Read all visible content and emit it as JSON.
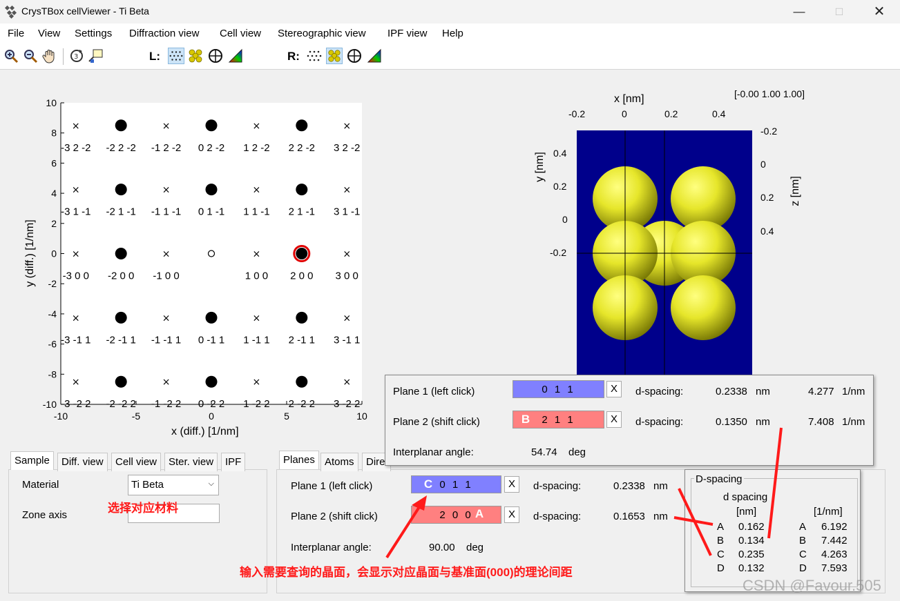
{
  "window": {
    "title": "CrysTBox cellViewer - Ti Beta",
    "icons": {
      "app": "crystal-app-icon",
      "minimize": "minimize-icon",
      "maximize": "maximize-icon",
      "close": "close-icon"
    }
  },
  "menu": [
    "File",
    "View",
    "Settings",
    "Diffraction view",
    "Cell view",
    "Stereographic view",
    "IPF view",
    "Help"
  ],
  "toolbar": {
    "left_label": "L:",
    "right_label": "R:",
    "icons": [
      "zoom-in-icon",
      "zoom-out-icon",
      "pan-hand-icon",
      "rotate-3d-icon",
      "data-cursor-icon"
    ],
    "left_group_icons": [
      "pattern-dots-icon",
      "atoms-icon",
      "stereo-net-icon",
      "color-triangle-icon"
    ],
    "right_group_icons": [
      "pattern-dots-icon",
      "atoms-icon",
      "stereo-net-icon",
      "color-triangle-icon"
    ]
  },
  "diffraction": {
    "xlabel": "x (diff.) [1/nm]",
    "ylabel": "y (diff.) [1/nm]",
    "xticks": [
      "-10",
      "-5",
      "0",
      "5",
      "10"
    ],
    "yticks": [
      "10",
      "8",
      "6",
      "4",
      "2",
      "0",
      "-2",
      "-4",
      "-6",
      "-8",
      "-10"
    ],
    "xlim": [
      -10,
      10
    ],
    "ylim": [
      -10,
      10
    ],
    "rows": [
      {
        "y": 8.5,
        "labels": [
          "-3 2 -2",
          "-2 2 -2",
          "-1 2 -2",
          "0 2 -2",
          "1 2 -2",
          "2 2 -2",
          "3 2 -2"
        ]
      },
      {
        "y": 4.25,
        "labels": [
          "-3 1 -1",
          "-2 1 -1",
          "-1 1 -1",
          "0 1 -1",
          "1 1 -1",
          "2 1 -1",
          "3 1 -1"
        ]
      },
      {
        "y": 0,
        "labels": [
          "-3 0 0",
          "-2 0 0",
          "-1 0 0",
          "",
          "1 0 0",
          "2 0 0",
          "3 0 0"
        ]
      },
      {
        "y": -4.25,
        "labels": [
          "-3 -1 1",
          "-2 -1 1",
          "-1 -1 1",
          "0 -1 1",
          "1 -1 1",
          "2 -1 1",
          "3 -1 1"
        ]
      },
      {
        "y": -8.5,
        "labels": [
          "-3 -2 2",
          "-2 -2 2",
          "-1 -2 2",
          "0 -2 2",
          "1 -2 2",
          "2 -2 2",
          "3 -2 2"
        ]
      }
    ],
    "columns_x": [
      -9,
      -6,
      -3,
      0,
      3,
      6,
      9
    ],
    "spot_columns": [
      -6,
      0,
      6
    ],
    "highlight": {
      "x": 6,
      "y": 0,
      "color": "#e00000"
    },
    "origin_open": {
      "x": 0,
      "y": 0
    }
  },
  "cell": {
    "top_xlabel": "x [nm]",
    "left_ylabel": "y [nm]",
    "right_ylabel": "z [nm]",
    "direction": "[-0.00 1.00 1.00]",
    "xticks": [
      "-0.2",
      "0",
      "0.2",
      "0.4"
    ],
    "yticks": [
      "0.4",
      "0.2",
      "0",
      "-0.2"
    ],
    "zticks": [
      "-0.2",
      "0",
      "0.2",
      "0.4"
    ],
    "background": "#00008b",
    "atom_color": "#e6e62a"
  },
  "popup": {
    "plane1_label": "Plane 1 (left click)",
    "plane1_value": "0 1 1",
    "plane1_x": "X",
    "plane1_dlabel": "d-spacing:",
    "plane1_d": "0.2338",
    "plane1_unit": "nm",
    "plane1_inv": "4.277",
    "plane1_invunit": "1/nm",
    "plane2_label": "Plane 2 (shift click)",
    "plane2_value": "2 1 1",
    "plane2_x": "X",
    "plane2_dlabel": "d-spacing:",
    "plane2_d": "0.1350",
    "plane2_unit": "nm",
    "plane2_inv": "7.408",
    "plane2_invunit": "1/nm",
    "angle_label": "Interplanar angle:",
    "angle_value": "54.74",
    "angle_unit": "deg",
    "badge": "B"
  },
  "left_tabs": [
    "Sample",
    "Diff. view",
    "Cell view",
    "Ster. view",
    "IPF"
  ],
  "sample": {
    "material_label": "Material",
    "material_value": "Ti Beta",
    "zone_label": "Zone axis",
    "zone_value": ""
  },
  "right_tabs": [
    "Planes",
    "Atoms",
    "Dire"
  ],
  "planes": {
    "plane1_label": "Plane 1 (left click)",
    "plane1_value": "0 1 1",
    "plane1_x": "X",
    "plane1_dlabel": "d-spacing:",
    "plane1_d": "0.2338",
    "plane1_unit": "nm",
    "plane2_label": "Plane 2 (shift click)",
    "plane2_value": "2 0 0",
    "plane2_x": "X",
    "plane2_dlabel": "d-spacing:",
    "plane2_d": "0.1653",
    "plane2_unit": "nm",
    "angle_label": "Interplanar angle:",
    "angle_value": "90.00",
    "angle_unit": "deg",
    "badge_c": "C",
    "badge_a": "A"
  },
  "dspacing": {
    "title": "D-spacing",
    "header1": "d spacing",
    "col_nm": "[nm]",
    "col_inv": "[1/nm]",
    "rows": [
      {
        "k": "A",
        "nm": "0.162",
        "inv": "6.192"
      },
      {
        "k": "B",
        "nm": "0.134",
        "inv": "7.442"
      },
      {
        "k": "C",
        "nm": "0.235",
        "inv": "4.263"
      },
      {
        "k": "D",
        "nm": "0.132",
        "inv": "7.593"
      }
    ]
  },
  "annotations": {
    "material_note": "选择对应材料",
    "plane_note": "输入需要查询的晶面，会显示对应晶面与基准面(000)的理论间距",
    "watermark": "CSDN @Favour.505"
  },
  "colors": {
    "plane1_field": "#8080ff",
    "plane2_field": "#ff8080",
    "annotation": "#ff1a1a"
  }
}
